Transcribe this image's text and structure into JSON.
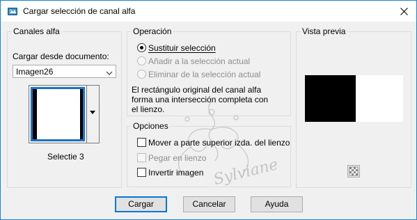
{
  "window": {
    "title": "Cargar selección de canal alfa",
    "icon": "paint-app-icon",
    "close_icon": "close-icon"
  },
  "left_panel": {
    "group_title": "Canales alfa",
    "source_label": "Cargar desde documento:",
    "document_value": "Imagen26",
    "selection_name": "Selectie 3"
  },
  "operation": {
    "group_title": "Operación",
    "options": [
      {
        "label": "Sustituir selección",
        "selected": true,
        "enabled": true
      },
      {
        "label": "Añadir a la selección actual",
        "selected": false,
        "enabled": false
      },
      {
        "label": "Eliminar de la selección actual",
        "selected": false,
        "enabled": false
      }
    ],
    "note_line1": "El rectángulo original del canal alfa",
    "note_line2": "forma una intersección completa con",
    "note_line3": "el lienzo."
  },
  "options": {
    "group_title": "Opciones",
    "items": [
      {
        "label": "Mover a parte superior izda. del lienzo",
        "checked": false,
        "enabled": true
      },
      {
        "label": "Pegar en lienzo",
        "checked": false,
        "enabled": false
      },
      {
        "label": "Invertir imagen",
        "checked": false,
        "enabled": true
      }
    ]
  },
  "preview": {
    "group_title": "Vista previa",
    "zoom_icon": "checker-preview-icon"
  },
  "buttons": {
    "load": "Cargar",
    "cancel": "Cancelar",
    "help": "Ayuda"
  },
  "watermark": {
    "text": "Sylviane"
  },
  "colors": {
    "accent": "#0078d7",
    "window_border": "#1883d7",
    "background": "#f0f0f0"
  }
}
